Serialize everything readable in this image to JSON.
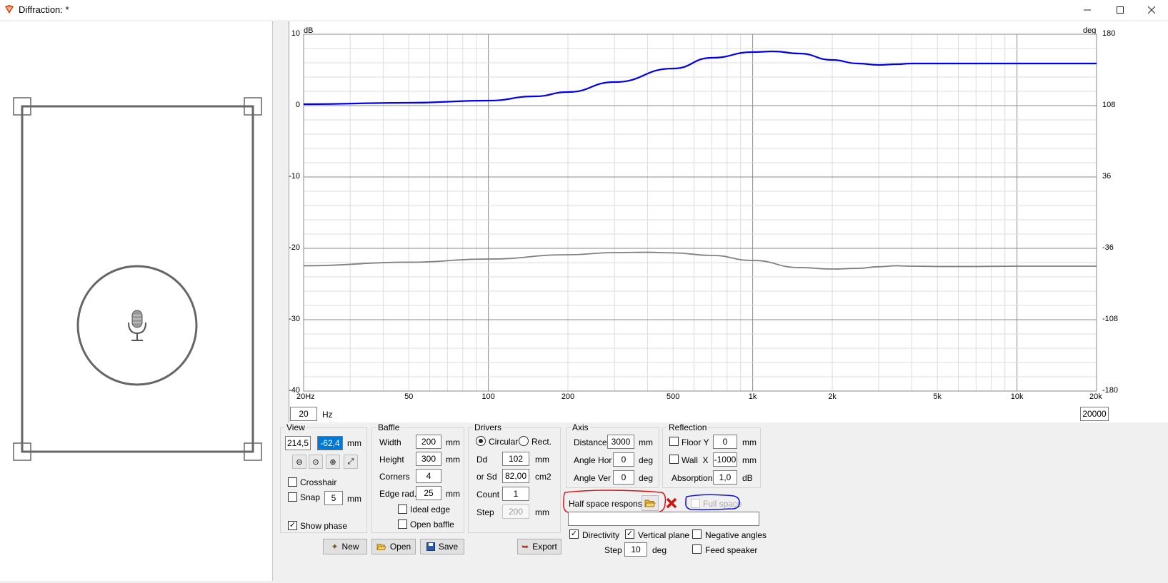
{
  "window": {
    "title": "Diffraction: *"
  },
  "plot": {
    "y_left_unit": "dB",
    "y_right_unit": "deg",
    "y_left_ticks": [
      "10",
      "0",
      "-10",
      "-20",
      "-30",
      "-40"
    ],
    "y_right_ticks": [
      "180",
      "108",
      "36",
      "-36",
      "-108",
      "-180"
    ],
    "x_ticks": [
      "20Hz",
      "50",
      "100",
      "200",
      "500",
      "1k",
      "2k",
      "5k",
      "10k",
      "20k"
    ],
    "freq_min": "20",
    "freq_min_unit": "Hz",
    "freq_max": "20000"
  },
  "chart_data": {
    "type": "line",
    "x_scale": "log",
    "xlim": [
      20,
      20000
    ],
    "ylim": [
      -40,
      10
    ],
    "y2lim": [
      -180,
      180
    ],
    "series": [
      {
        "axis": "dB",
        "color": "#0000ee",
        "x": [
          20,
          50,
          100,
          150,
          200,
          300,
          500,
          700,
          1000,
          1200,
          1500,
          2000,
          2500,
          3000,
          3500,
          4000,
          5000,
          7000,
          10000,
          15000,
          20000
        ],
        "y": [
          0.2,
          0.4,
          0.7,
          1.3,
          1.9,
          3.3,
          5.2,
          6.7,
          7.5,
          7.6,
          7.3,
          6.4,
          5.9,
          5.7,
          5.8,
          5.9,
          5.9,
          5.9,
          5.9,
          5.9,
          5.9
        ]
      },
      {
        "axis": "deg",
        "color": "#808080",
        "x": [
          20,
          50,
          100,
          200,
          300,
          400,
          500,
          700,
          1000,
          1500,
          2000,
          2500,
          3000,
          3500,
          4000,
          5000,
          7000,
          10000,
          15000,
          20000
        ],
        "y": [
          -53.6,
          -50,
          -46.8,
          -42.5,
          -40.3,
          -40.0,
          -40.6,
          -43.2,
          -48.2,
          -55.4,
          -56.9,
          -56.2,
          -54.6,
          -53.6,
          -54.0,
          -54.3,
          -54.3,
          -54.0,
          -54.0,
          -54.0
        ]
      }
    ]
  },
  "view": {
    "label": "View",
    "x": "214,5",
    "y": "-62,4",
    "unit": "mm",
    "crosshair_label": "Crosshair",
    "snap_label": "Snap",
    "snap_value": "5",
    "snap_unit": "mm",
    "show_phase_label": "Show phase"
  },
  "baffle": {
    "label": "Baffle",
    "width_label": "Width",
    "width": "200",
    "width_unit": "mm",
    "height_label": "Height",
    "height": "300",
    "height_unit": "mm",
    "corners_label": "Corners",
    "corners": "4",
    "edge_label": "Edge rad.",
    "edge": "25",
    "edge_unit": "mm",
    "ideal_edge_label": "Ideal edge",
    "open_baffle_label": "Open baffle"
  },
  "drivers": {
    "label": "Drivers",
    "circular_label": "Circular",
    "rect_label": "Rect.",
    "dd_label": "Dd",
    "dd": "102",
    "dd_unit": "mm",
    "sd_label": "or Sd",
    "sd": "82,00",
    "sd_unit": "cm2",
    "count_label": "Count",
    "count": "1",
    "step_label": "Step",
    "step": "200",
    "step_unit": "mm"
  },
  "axis": {
    "label": "Axis",
    "distance_label": "Distance",
    "distance": "3000",
    "distance_unit": "mm",
    "hor_label": "Angle Hor",
    "hor": "0",
    "hor_unit": "deg",
    "ver_label": "Angle Ver",
    "ver": "0",
    "ver_unit": "deg"
  },
  "reflection": {
    "label": "Reflection",
    "floor_label": "Floor Y",
    "floor": "0",
    "floor_unit": "mm",
    "wall_label": "Wall  X",
    "wall": "-1000",
    "wall_unit": "mm",
    "absorption_label": "Absorption",
    "absorption": "1,0",
    "absorption_unit": "dB"
  },
  "response": {
    "half_space_label": "Half space response",
    "full_space_label": "Full space"
  },
  "options": {
    "directivity_label": "Directivity",
    "vertical_plane_label": "Vertical plane",
    "negative_angles_label": "Negative angles",
    "feed_speaker_label": "Feed speaker",
    "step_label": "Step",
    "step": "10",
    "step_unit": "deg"
  },
  "buttons": {
    "new": "New",
    "open": "Open",
    "save": "Save",
    "export": "Export"
  },
  "icons": {
    "app": "diamond-speaker-icon",
    "microphone": "microphone-icon",
    "folder": "folder-open-icon",
    "delete": "red-x-icon"
  }
}
